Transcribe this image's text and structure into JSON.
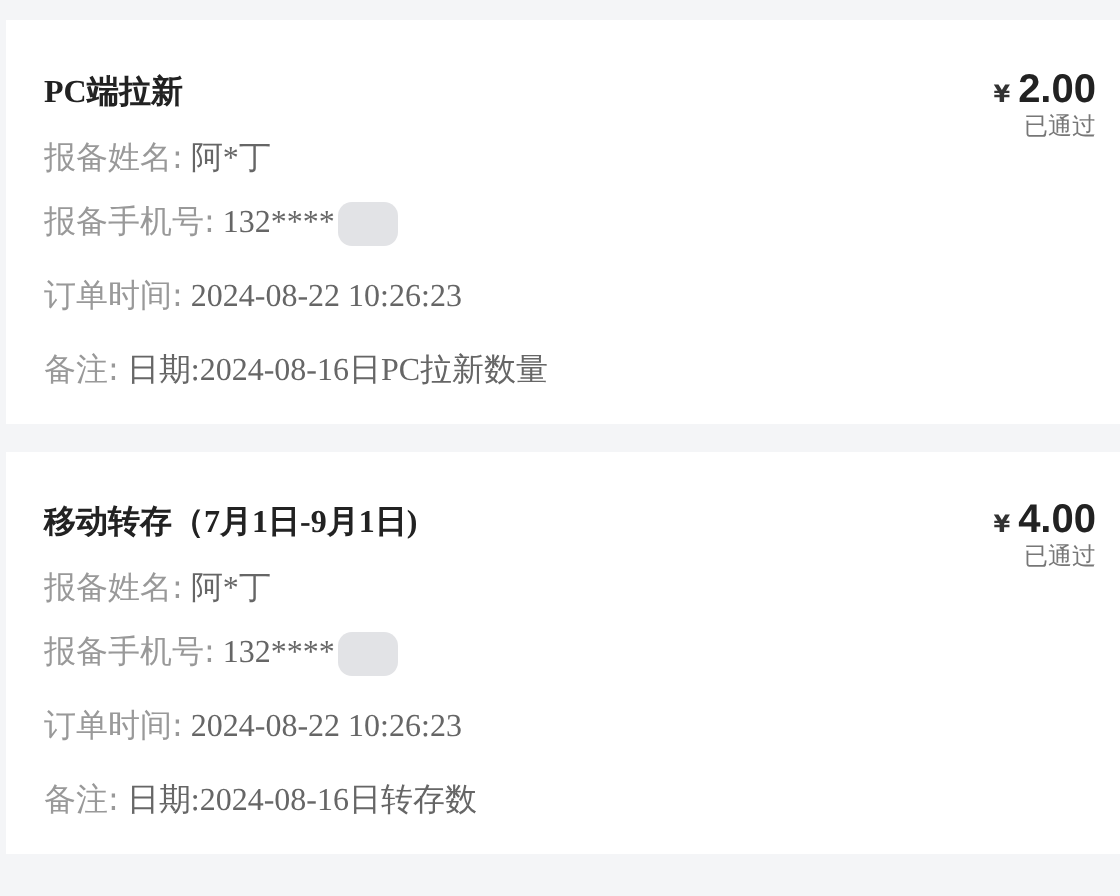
{
  "orders": [
    {
      "title": "PC端拉新",
      "currency": "¥",
      "amount": "2.00",
      "status": "已通过",
      "fields": [
        {
          "label": "报备姓名:",
          "value": "阿*丁",
          "redacted": false
        },
        {
          "label": "报备手机号:",
          "value": "132****",
          "redacted": true
        },
        {
          "label": "订单时间:",
          "value": "2024-08-22 10:26:23",
          "redacted": false
        },
        {
          "label": "备注:",
          "value": "日期:2024-08-16日PC拉新数量",
          "redacted": false
        }
      ]
    },
    {
      "title": "移动转存（7月1日-9月1日)",
      "currency": "¥",
      "amount": "4.00",
      "status": "已通过",
      "fields": [
        {
          "label": "报备姓名:",
          "value": "阿*丁",
          "redacted": false
        },
        {
          "label": "报备手机号:",
          "value": "132****",
          "redacted": true
        },
        {
          "label": "订单时间:",
          "value": "2024-08-22 10:26:23",
          "redacted": false
        },
        {
          "label": "备注:",
          "value": "日期:2024-08-16日转存数",
          "redacted": false
        }
      ]
    }
  ]
}
